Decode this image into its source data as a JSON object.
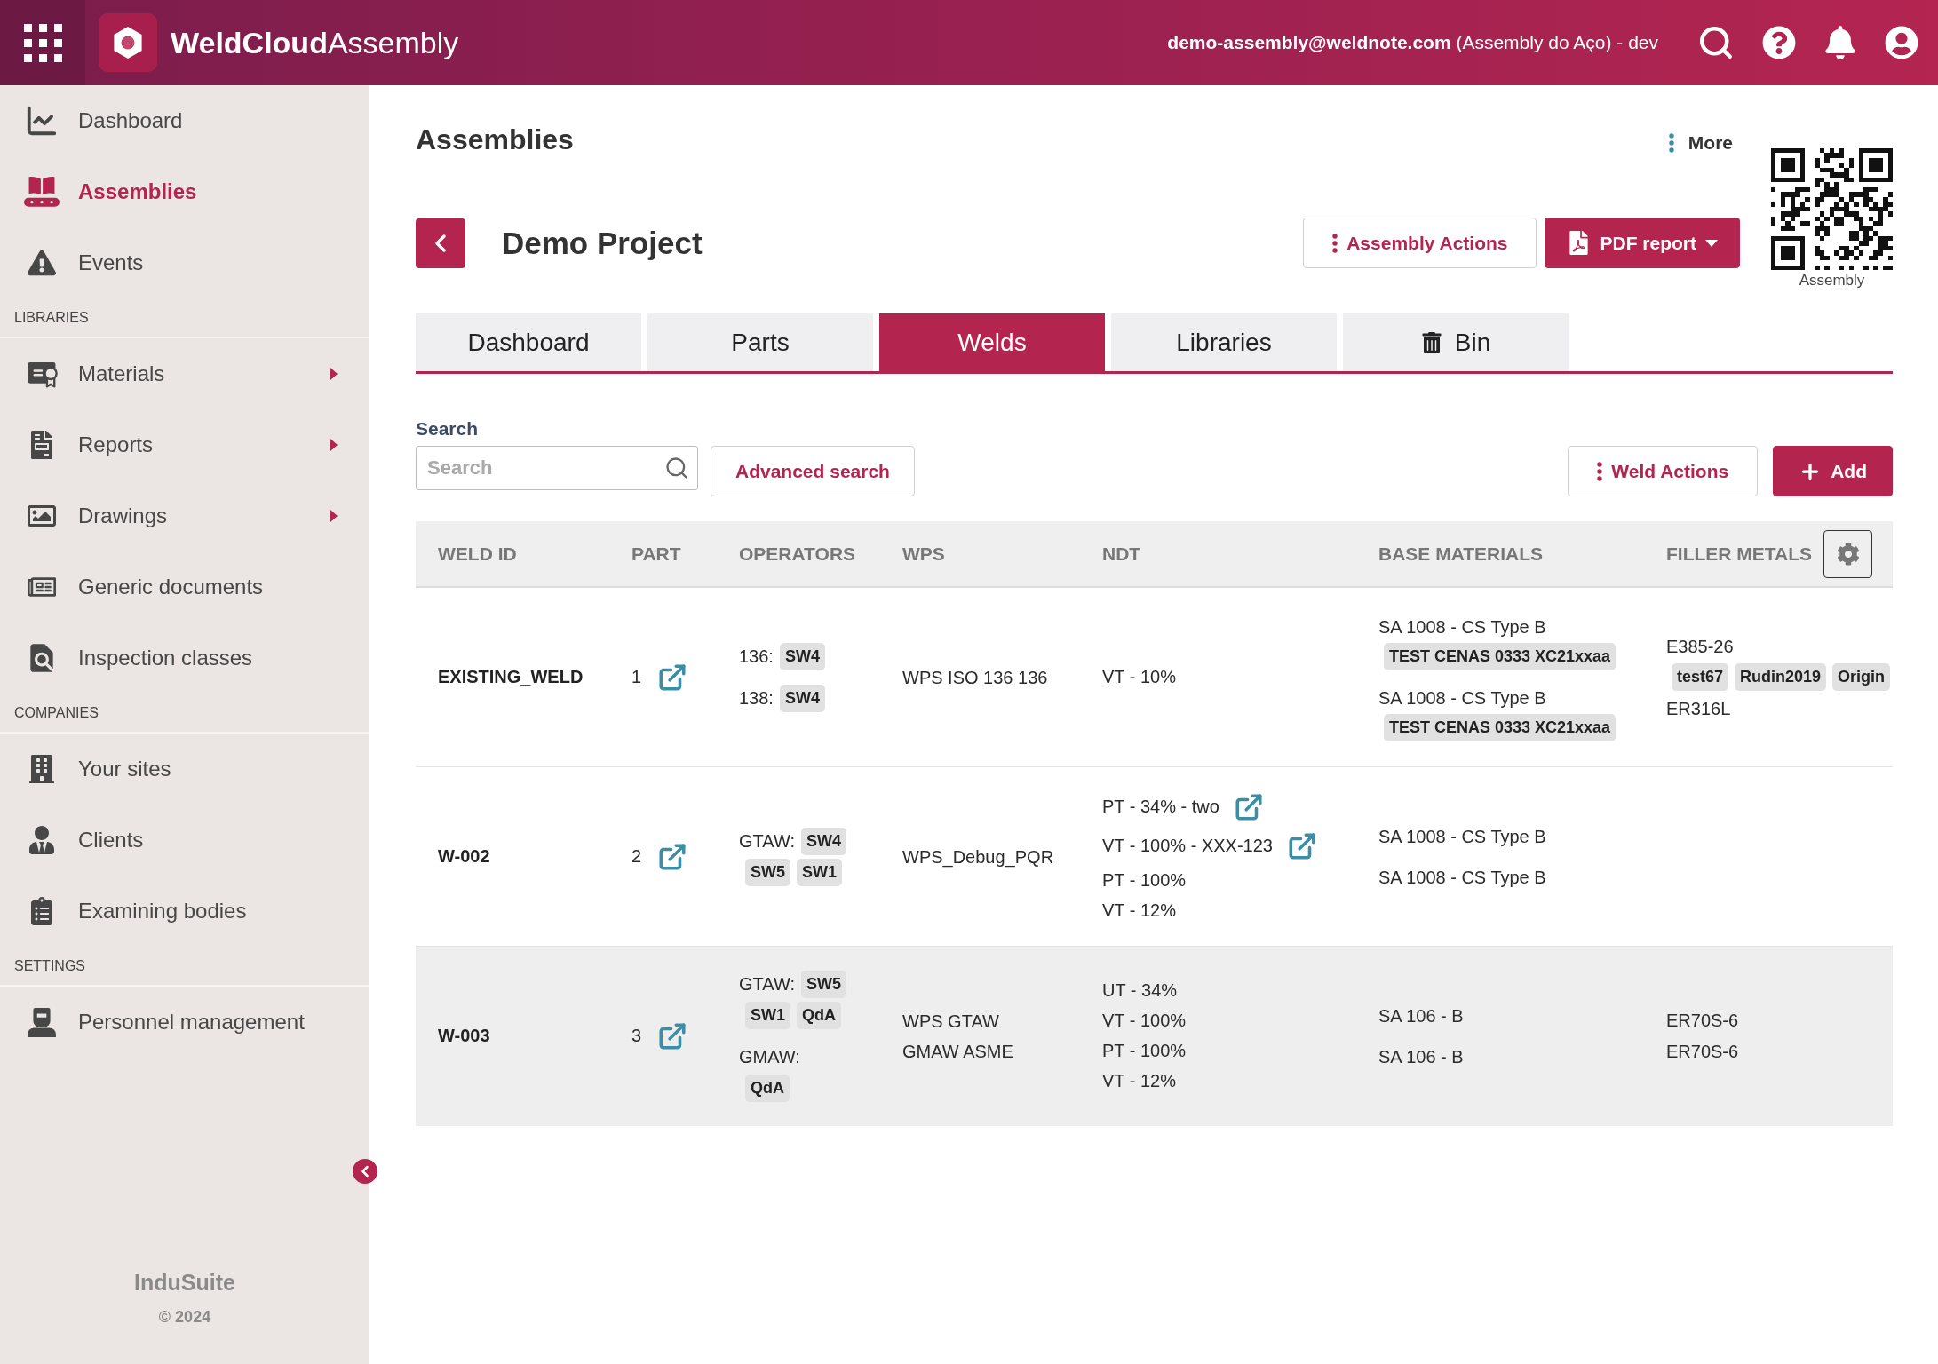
{
  "header": {
    "app_name": "**WeldCloud**Assembly",
    "account": "**demo-assembly@weldnote.com** (Assembly do Aço) - dev"
  },
  "sidebar": {
    "groups": [
      {
        "items": [
          {
            "label": "Dashboard",
            "selected": false,
            "has_submenu": false
          },
          {
            "label": "Assemblies",
            "selected": true,
            "has_submenu": false
          },
          {
            "label": "Events",
            "selected": false,
            "has_submenu": false
          }
        ]
      },
      {
        "title": "LIBRARIES",
        "items": [
          {
            "label": "Materials",
            "selected": false,
            "has_submenu": true
          },
          {
            "label": "Reports",
            "selected": false,
            "has_submenu": true
          },
          {
            "label": "Drawings",
            "selected": false,
            "has_submenu": true
          },
          {
            "label": "Generic documents",
            "selected": false,
            "has_submenu": false
          },
          {
            "label": "Inspection classes",
            "selected": false,
            "has_submenu": false
          }
        ]
      },
      {
        "title": "COMPANIES",
        "items": [
          {
            "label": "Your sites",
            "selected": false,
            "has_submenu": false
          },
          {
            "label": "Clients",
            "selected": false,
            "has_submenu": false
          },
          {
            "label": "Examining bodies",
            "selected": false,
            "has_submenu": false
          }
        ]
      },
      {
        "title": "SETTINGS",
        "items": [
          {
            "label": "Personnel management",
            "selected": false,
            "has_submenu": false
          }
        ]
      }
    ],
    "footer": {
      "brand": "InduSuite",
      "copyright": "© 2024"
    }
  },
  "page": {
    "title": "Assemblies",
    "more": "More",
    "qr_caption": "Assembly"
  },
  "project": {
    "name": "Demo Project",
    "buttons": [
      {
        "label": "Assembly Actions",
        "kind": "menu"
      },
      {
        "label": "PDF report",
        "kind": "pdf"
      }
    ]
  },
  "tabs": [
    {
      "label": "Dashboard",
      "selected": false,
      "kind": "text"
    },
    {
      "label": "Parts",
      "selected": false,
      "kind": "text"
    },
    {
      "label": "Welds",
      "selected": true,
      "kind": "text"
    },
    {
      "label": "Libraries",
      "selected": false,
      "kind": "text"
    },
    {
      "label": "Bin",
      "selected": false,
      "kind": "bin"
    }
  ],
  "search": {
    "label": "Search",
    "placeholder": "Search",
    "advanced": "Advanced search"
  },
  "toolbar": {
    "buttons": [
      {
        "label": "Weld Actions",
        "kind": "menu"
      },
      {
        "label": "Add",
        "kind": "add"
      }
    ]
  },
  "table": {
    "columns": [
      "WELD ID",
      "PART",
      "OPERATORS",
      "WPS",
      "NDT",
      "BASE MATERIALS",
      "FILLER METALS"
    ],
    "rows": [
      {
        "weld_id": "EXISTING_WELD",
        "part": "1",
        "hovered": false,
        "operators": [
          {
            "process": "136:",
            "welders": [
              "SW4"
            ]
          },
          {
            "process": "138:",
            "welders": [
              "SW4"
            ]
          }
        ],
        "wps": "WPS ISO 136 136",
        "ndt": [
          {
            "text": "VT - 10%",
            "linked": false
          }
        ],
        "base_materials": [
          {
            "name": "SA 1008 - CS Type B",
            "tags": [
              "TEST CENAS 0333 XC21xxaa"
            ]
          },
          {
            "name": "SA 1008 - CS Type B",
            "tags": [
              "TEST CENAS 0333 XC21xxaa"
            ]
          }
        ],
        "filler_metals": [
          {
            "name": "E385-26",
            "tags": [
              "test67",
              "Rudin2019",
              "Origin"
            ]
          },
          {
            "name": "ER316L"
          }
        ]
      },
      {
        "weld_id": "W-002",
        "part": "2",
        "hovered": false,
        "operators": [
          {
            "process": "GTAW:",
            "welders": [
              "SW4",
              "SW5",
              "SW1"
            ]
          }
        ],
        "wps": "WPS_Debug_PQR",
        "ndt": [
          {
            "text": "PT - 34% - two",
            "linked": true
          },
          {
            "text": "VT - 100% - XXX-123",
            "linked": true
          },
          {
            "text": "PT - 100%",
            "linked": false
          },
          {
            "text": "VT - 12%",
            "linked": false
          }
        ],
        "base_materials": [
          {
            "name": "SA 1008 - CS Type B"
          },
          {
            "name": "SA 1008 - CS Type B"
          }
        ]
      },
      {
        "weld_id": "W-003",
        "part": "3",
        "hovered": true,
        "operators": [
          {
            "process": "GTAW:",
            "welders": [
              "SW5",
              "SW1",
              "QdA"
            ]
          },
          {
            "process": "GMAW:",
            "welders": [
              "QdA"
            ]
          }
        ],
        "wps": "WPS GTAW GMAW ASME",
        "ndt": [
          {
            "text": "UT - 34%",
            "linked": false
          },
          {
            "text": "VT - 100%",
            "linked": false
          },
          {
            "text": "PT - 100%",
            "linked": false
          },
          {
            "text": "VT - 12%",
            "linked": false
          }
        ],
        "base_materials": [
          {
            "name": "SA 106 - B"
          },
          {
            "name": "SA 106 - B"
          }
        ],
        "filler_metals": [
          {
            "name": "ER70S-6"
          },
          {
            "name": "ER70S-6"
          }
        ]
      }
    ]
  }
}
